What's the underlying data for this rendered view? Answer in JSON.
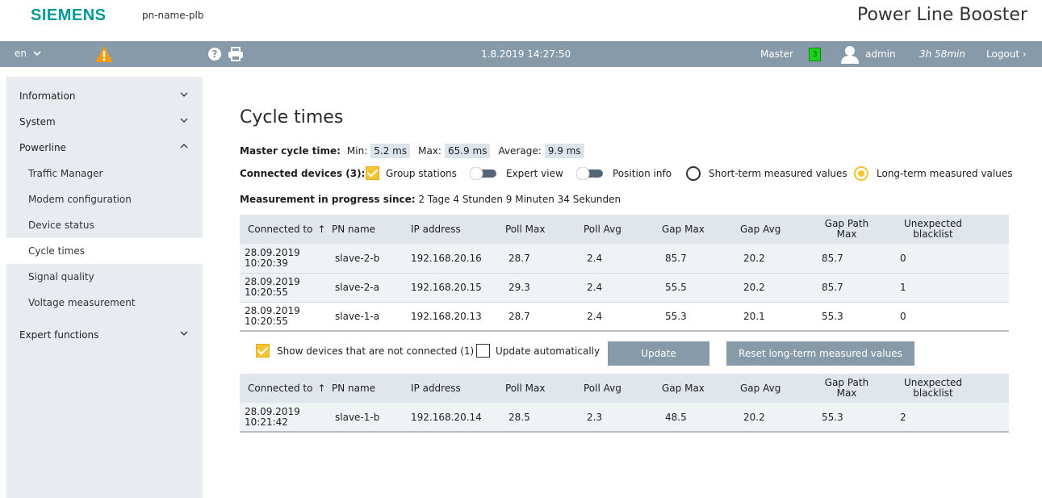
{
  "header": {
    "brand": "SIEMENS",
    "device_name": "pn-name-plb",
    "product": "Power Line Booster"
  },
  "navbar": {
    "language": "en",
    "datetime": "1.8.2019 14:27:50",
    "master_label": "Master",
    "master_badge": "3",
    "user": "admin",
    "session_time": "3h 58min",
    "logout": "Logout ›"
  },
  "sidebar": {
    "items": [
      {
        "label": "Information"
      },
      {
        "label": "System"
      },
      {
        "label": "Powerline"
      },
      {
        "label": "Traffic Manager"
      },
      {
        "label": "Modem configuration"
      },
      {
        "label": "Device status"
      },
      {
        "label": "Cycle times"
      },
      {
        "label": "Signal quality"
      },
      {
        "label": "Voltage measurement"
      },
      {
        "label": "Expert functions"
      }
    ]
  },
  "main": {
    "title": "Cycle times",
    "master_cycle_label": "Master cycle time:",
    "min_label": "Min:",
    "min_value": "5.2 ms",
    "max_label": "Max:",
    "max_value": "65.9 ms",
    "avg_label": "Average:",
    "avg_value": "9.9 ms",
    "connected_label": "Connected devices (3):",
    "group_stations": "Group stations",
    "expert_view": "Expert view",
    "position_info": "Position info",
    "short_term": "Short-term measured values",
    "long_term": "Long-term measured values",
    "progress_label": "Measurement in progress since:",
    "progress_value": "2 Tage 4 Stunden 9 Minuten 34 Sekunden",
    "show_devices": "Show devices that are not connected (1)",
    "update_auto": "Update automatically",
    "update_btn": "Update",
    "reset_btn": "Reset long-term measured values"
  },
  "table": {
    "headers": [
      "Connected to",
      "PN name",
      "IP address",
      "Poll Max",
      "Poll Avg",
      "Gap Max",
      "Gap Avg",
      "Gap Path Max",
      "Unexpected blacklist"
    ],
    "rows": [
      {
        "date": "28.09.2019",
        "time": "10:20:39",
        "pn": "slave-2-b",
        "ip": "192.168.20.16",
        "poll_max": "28.7",
        "poll_avg": "2.4",
        "gap_max": "85.7",
        "gap_avg": "20.2",
        "gap_path": "85.7",
        "blacklist": "0"
      },
      {
        "date": "28.09.2019",
        "time": "10:20:55",
        "pn": "slave-2-a",
        "ip": "192.168.20.15",
        "poll_max": "29.3",
        "poll_avg": "2.4",
        "gap_max": "55.5",
        "gap_avg": "20.2",
        "gap_path": "85.7",
        "blacklist": "1"
      },
      {
        "date": "28.09.2019",
        "time": "10:20:55",
        "pn": "slave-1-a",
        "ip": "192.168.20.13",
        "poll_max": "28.7",
        "poll_avg": "2.4",
        "gap_max": "55.3",
        "gap_avg": "20.1",
        "gap_path": "55.3",
        "blacklist": "0"
      }
    ],
    "disconnected_rows": [
      {
        "date": "28.09.2019",
        "time": "10:21:42",
        "pn": "slave-1-b",
        "ip": "192.168.20.14",
        "poll_max": "28.5",
        "poll_avg": "2.3",
        "gap_max": "48.5",
        "gap_avg": "20.2",
        "gap_path": "55.3",
        "blacklist": "2"
      }
    ]
  },
  "colors": {
    "accent": "#f5c431",
    "navbar": "#879aa9",
    "brand": "#009999",
    "master_badge": "#1dd31d"
  }
}
